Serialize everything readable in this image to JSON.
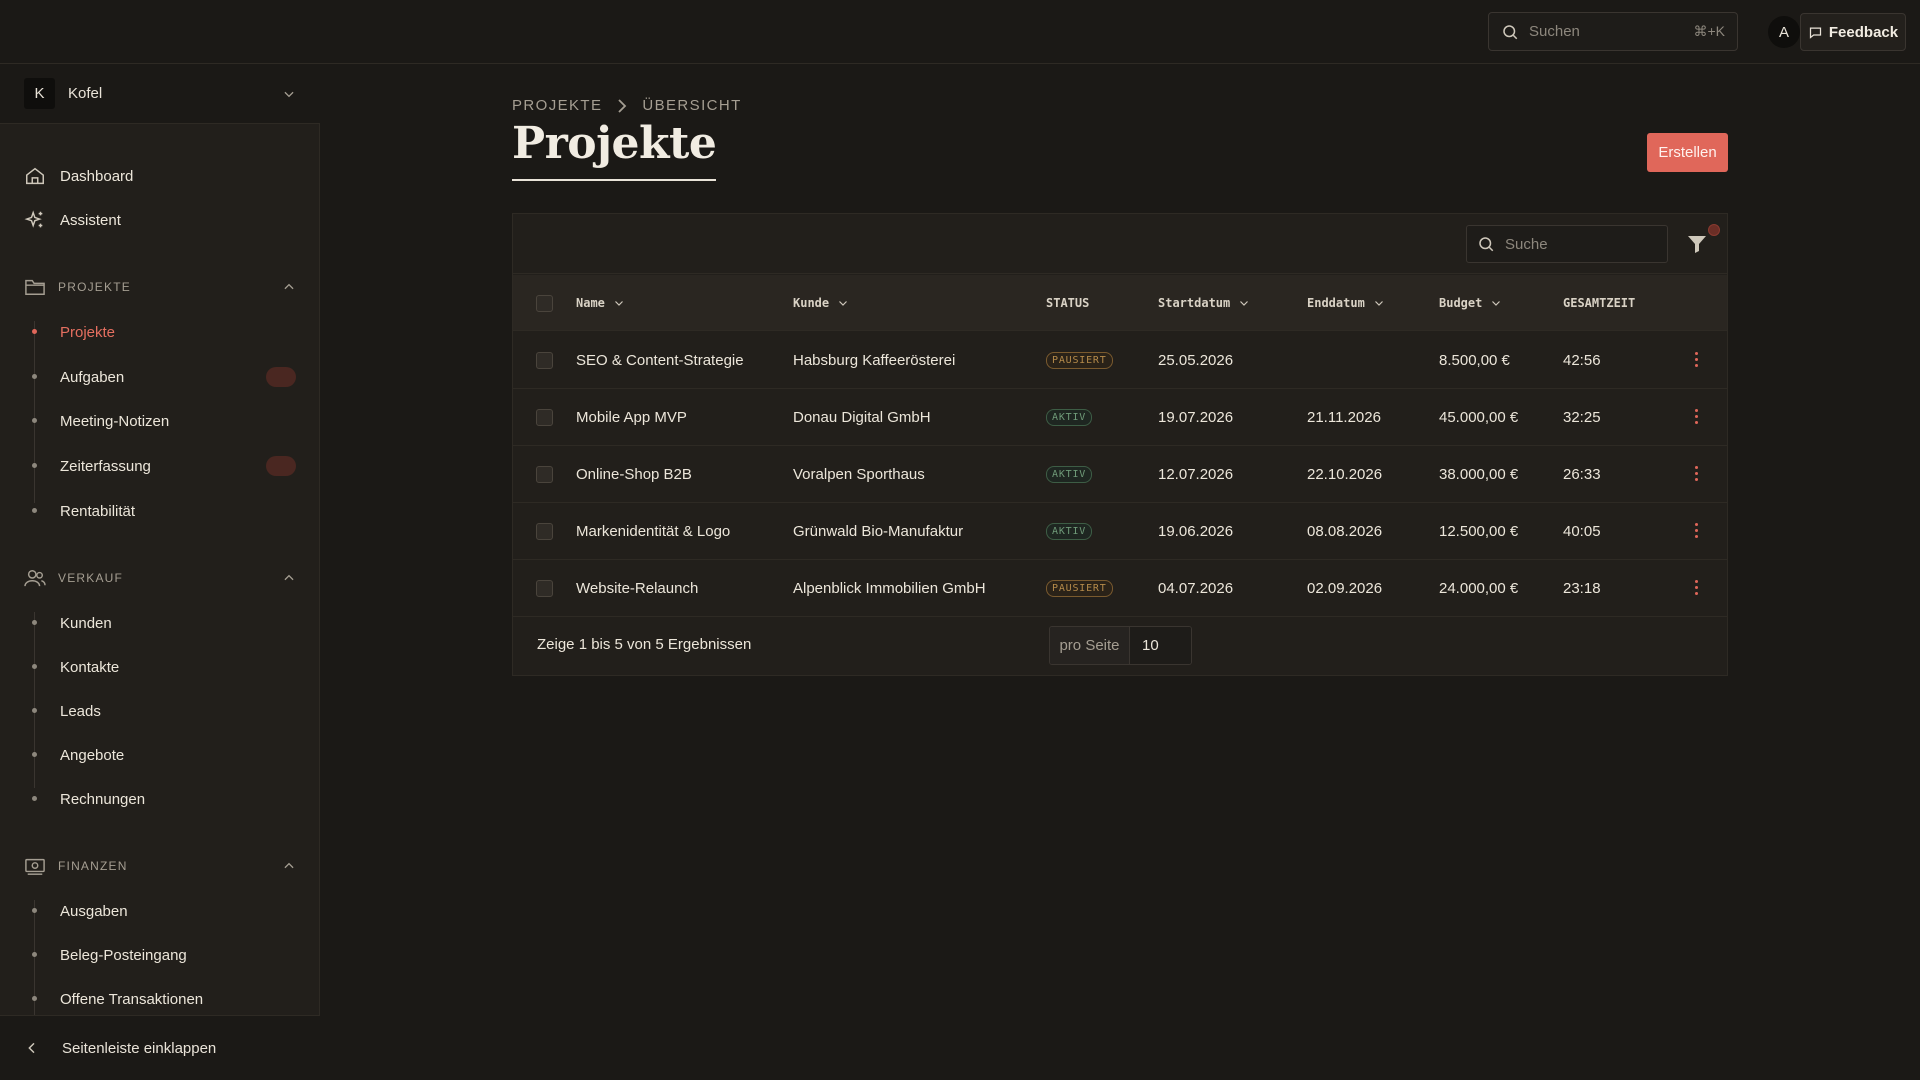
{
  "topbar": {
    "search_placeholder": "Suchen",
    "search_shortcut": "⌘+K",
    "avatar_initial": "A",
    "feedback_label": "Feedback"
  },
  "sidebar": {
    "workspace": {
      "initial": "K",
      "name": "Kofel"
    },
    "top_items": [
      {
        "label": "Dashboard",
        "icon": "home-icon"
      },
      {
        "label": "Assistent",
        "icon": "sparkles-icon"
      }
    ],
    "sections": [
      {
        "title": "PROJEKTE",
        "icon": "folder-icon",
        "items": [
          {
            "label": "Projekte",
            "active": true
          },
          {
            "label": "Aufgaben",
            "badge": ""
          },
          {
            "label": "Meeting-Notizen"
          },
          {
            "label": "Zeiterfassung",
            "badge": ""
          },
          {
            "label": "Rentabilität"
          }
        ]
      },
      {
        "title": "VERKAUF",
        "icon": "users-icon",
        "items": [
          {
            "label": "Kunden"
          },
          {
            "label": "Kontakte"
          },
          {
            "label": "Leads"
          },
          {
            "label": "Angebote"
          },
          {
            "label": "Rechnungen"
          }
        ]
      },
      {
        "title": "FINANZEN",
        "icon": "money-icon",
        "items": [
          {
            "label": "Ausgaben"
          },
          {
            "label": "Beleg-Posteingang"
          },
          {
            "label": "Offene Transaktionen"
          }
        ]
      }
    ],
    "collapse_label": "Seitenleiste einklappen"
  },
  "main": {
    "breadcrumb": [
      "PROJEKTE",
      "ÜBERSICHT"
    ],
    "title": "Projekte",
    "create_label": "Erstellen",
    "table_search_placeholder": "Suche",
    "columns": [
      "Name",
      "Kunde",
      "STATUS",
      "Startdatum",
      "Enddatum",
      "Budget",
      "GESAMTZEIT"
    ],
    "rows": [
      {
        "name": "SEO & Content-Strategie",
        "kunde": "Habsburg Kaffeerösterei",
        "status": "PAUSIERT",
        "start": "25.05.2026",
        "end": "",
        "budget": "8.500,00 €",
        "time": "42:56"
      },
      {
        "name": "Mobile App MVP",
        "kunde": "Donau Digital GmbH",
        "status": "AKTIV",
        "start": "19.07.2026",
        "end": "21.11.2026",
        "budget": "45.000,00 €",
        "time": "32:25"
      },
      {
        "name": "Online-Shop B2B",
        "kunde": "Voralpen Sporthaus",
        "status": "AKTIV",
        "start": "12.07.2026",
        "end": "22.10.2026",
        "budget": "38.000,00 €",
        "time": "26:33"
      },
      {
        "name": "Markenidentität & Logo",
        "kunde": "Grünwald Bio-Manufaktur",
        "status": "AKTIV",
        "start": "19.06.2026",
        "end": "08.08.2026",
        "budget": "12.500,00 €",
        "time": "40:05"
      },
      {
        "name": "Website-Relaunch",
        "kunde": "Alpenblick Immobilien GmbH",
        "status": "PAUSIERT",
        "start": "04.07.2026",
        "end": "02.09.2026",
        "budget": "24.000,00 €",
        "time": "23:18"
      }
    ],
    "result_text": "Zeige 1 bis 5 von 5 Ergebnissen",
    "per_page_label": "pro Seite",
    "per_page_value": "10"
  },
  "colors": {
    "accent": "#e0675a",
    "background": "#1b1916",
    "sidebar": "#221f1b",
    "status_paused": "#b48a4a",
    "status_active": "#6f9a78"
  }
}
